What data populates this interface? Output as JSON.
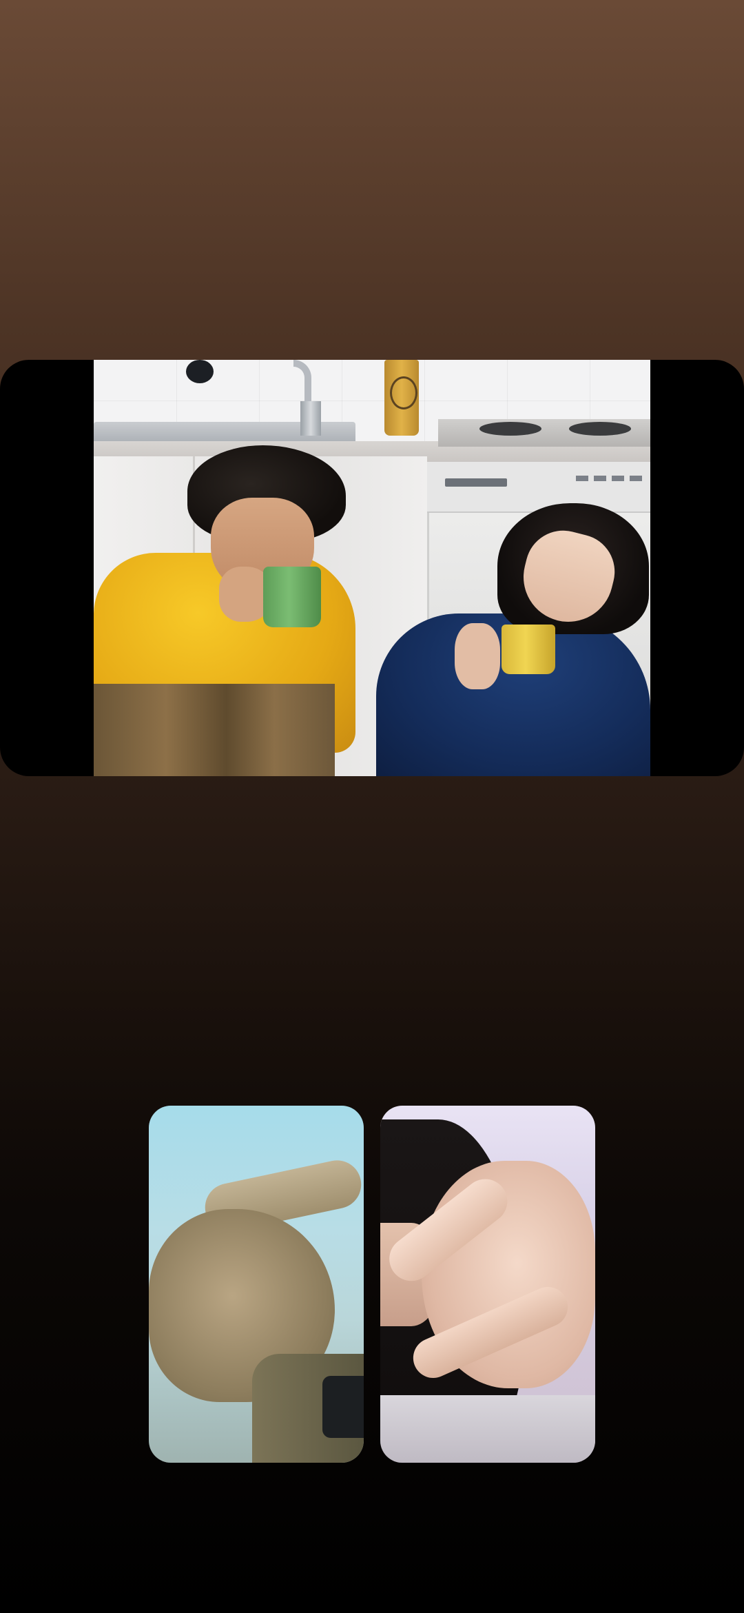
{
  "call": {
    "main_video": {
      "description_icon": "shared-video"
    },
    "participants": [
      {
        "id": "participant-1",
        "icon": "hand-gesture"
      },
      {
        "id": "participant-2",
        "icon": "heart-hand-gesture"
      }
    ]
  },
  "colors": {
    "background_top": "#6a4a36",
    "background_bottom": "#000000",
    "video_letterbox": "#000000"
  }
}
